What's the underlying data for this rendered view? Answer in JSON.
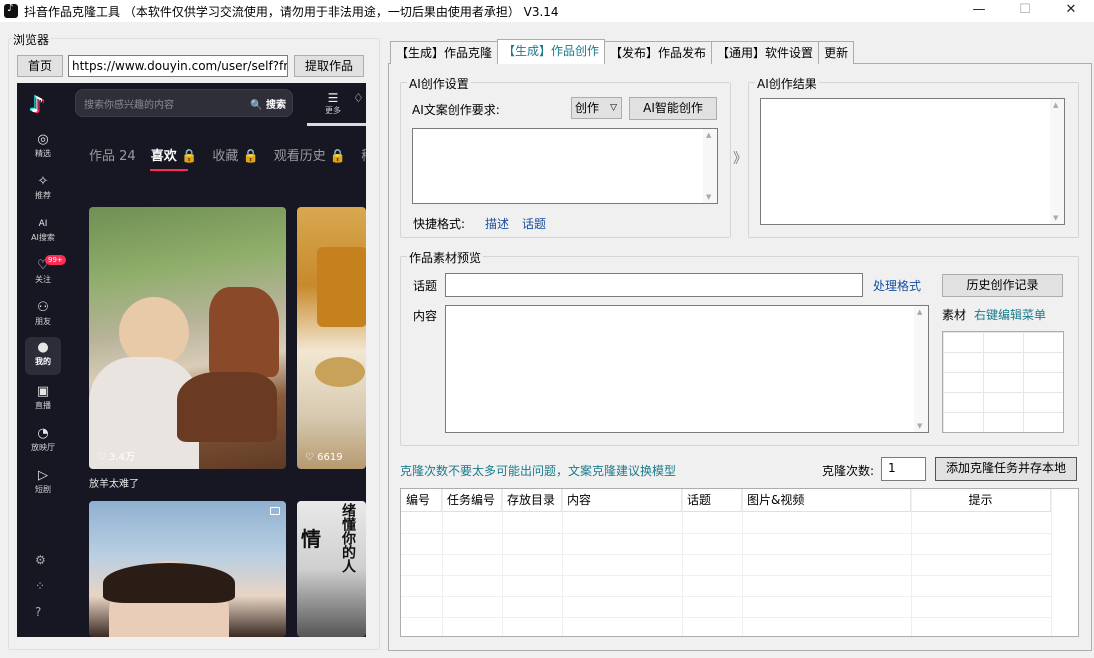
{
  "window": {
    "title": "抖音作品克隆工具 （本软件仅供学习交流使用，请勿用于非法用途，一切后果由使用者承担） V3.14",
    "minimize": "—",
    "maximize": "☐",
    "close": "✕"
  },
  "browser": {
    "group_label": "浏览器",
    "home_button": "首页",
    "url": "https://www.douyin.com/user/self?fro",
    "fetch_button": "提取作品"
  },
  "douyin": {
    "search_placeholder": "搜索你感兴趣的内容",
    "search_button": "搜索",
    "more_label": "更多",
    "nav": [
      {
        "icon": "◎",
        "label": "精选"
      },
      {
        "icon": "✧",
        "label": "推荐"
      },
      {
        "icon": "AI",
        "label": "AI搜索"
      },
      {
        "icon": "♡",
        "label": "关注",
        "badge": "99+"
      },
      {
        "icon": "⚇",
        "label": "朋友"
      },
      {
        "icon": "●",
        "label": "我的"
      },
      {
        "icon": "▣",
        "label": "直播"
      },
      {
        "icon": "◔",
        "label": "放映厅"
      },
      {
        "icon": "▷",
        "label": "短剧"
      }
    ],
    "tabs": [
      "作品 24",
      "喜欢 🔒",
      "收藏 🔒",
      "观看历史 🔒",
      "稍后"
    ],
    "cards": [
      {
        "likes": "♡ 3.4万",
        "caption": "放羊太难了"
      },
      {
        "likes": "♡ 6619"
      },
      {},
      {
        "big_text": "情",
        "vertical_text": "绪懂你的人"
      }
    ]
  },
  "tabs": [
    {
      "label": "【生成】作品克隆"
    },
    {
      "label": "【生成】作品创作"
    },
    {
      "label": "【发布】作品发布"
    },
    {
      "label": "【通用】软件设置"
    },
    {
      "label": "更新"
    }
  ],
  "ai_settings": {
    "legend": "AI创作设置",
    "requirement_label": "AI文案创作要求:",
    "mode_value": "创作",
    "ai_button": "AI智能创作",
    "quick_format_label": "快捷格式:",
    "quick_links": [
      "描述",
      "话题"
    ],
    "arrow": "》"
  },
  "ai_result": {
    "legend": "AI创作结果"
  },
  "preview": {
    "legend": "作品素材预览",
    "topic_label": "话题",
    "format_link": "处理格式",
    "history_button": "历史创作记录",
    "content_label": "内容",
    "material_label": "素材",
    "material_link": "右键编辑菜单"
  },
  "clone": {
    "note": "克隆次数不要太多可能出问题，文案克隆建议换模型",
    "count_label": "克隆次数:",
    "count_value": "1",
    "add_button": "添加克隆任务并存本地"
  },
  "table": {
    "columns": [
      "编号",
      "任务编号",
      "存放目录",
      "内容",
      "话题",
      "图片&视频",
      "提示"
    ]
  }
}
